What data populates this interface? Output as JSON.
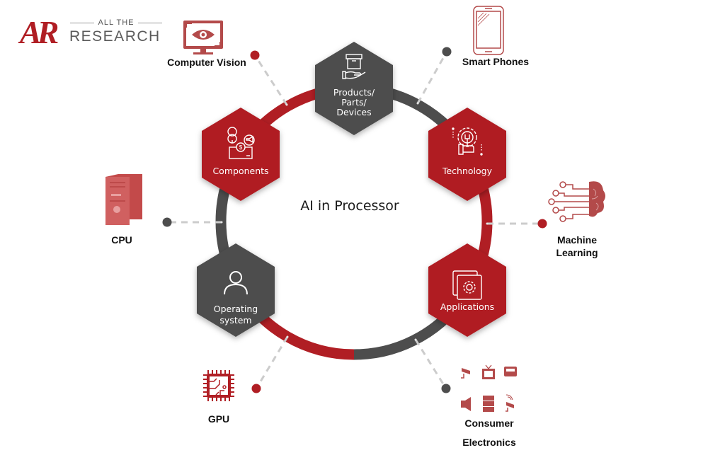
{
  "brand": {
    "logo_mark": "AR",
    "tagline_top": "ALL THE",
    "tagline_bottom": "RESEARCH"
  },
  "colors": {
    "red": "#b01e24",
    "gray": "#4d4d4d",
    "icon_red": "#b34a4a",
    "connector": "#cccccc"
  },
  "center_title": "AI in Processor",
  "hexagons": [
    {
      "id": "products",
      "lines": [
        "Products/",
        "Parts/",
        "Devices"
      ],
      "color": "gray",
      "icon": "hand-box-icon"
    },
    {
      "id": "technology",
      "lines": [
        "Technology"
      ],
      "color": "red",
      "icon": "gear-wrench-icon"
    },
    {
      "id": "applications",
      "lines": [
        "Applications"
      ],
      "color": "red",
      "icon": "app-window-gear-icon"
    },
    {
      "id": "operating-system",
      "lines": [
        "Operating",
        "system"
      ],
      "color": "gray",
      "icon": "user-icon"
    },
    {
      "id": "components",
      "lines": [
        "Components"
      ],
      "color": "red",
      "icon": "components-box-icon"
    }
  ],
  "outer_items": [
    {
      "id": "computer-vision",
      "lines": [
        "Computer Vision"
      ],
      "icon": "monitor-eye-icon",
      "dot": "red"
    },
    {
      "id": "smart-phones",
      "lines": [
        "Smart Phones"
      ],
      "icon": "smartphone-icon",
      "dot": "gray"
    },
    {
      "id": "machine-learning",
      "lines": [
        "Machine",
        "Learning"
      ],
      "icon": "brain-circuit-icon",
      "dot": "red"
    },
    {
      "id": "consumer-electronics",
      "lines": [
        "Consumer",
        "Electronics"
      ],
      "icon": "consumer-electronics-icons",
      "dot": "gray"
    },
    {
      "id": "gpu",
      "lines": [
        "GPU"
      ],
      "icon": "chip-icon",
      "dot": "red"
    },
    {
      "id": "cpu",
      "lines": [
        "CPU"
      ],
      "icon": "desktop-tower-icon",
      "dot": "gray"
    }
  ]
}
